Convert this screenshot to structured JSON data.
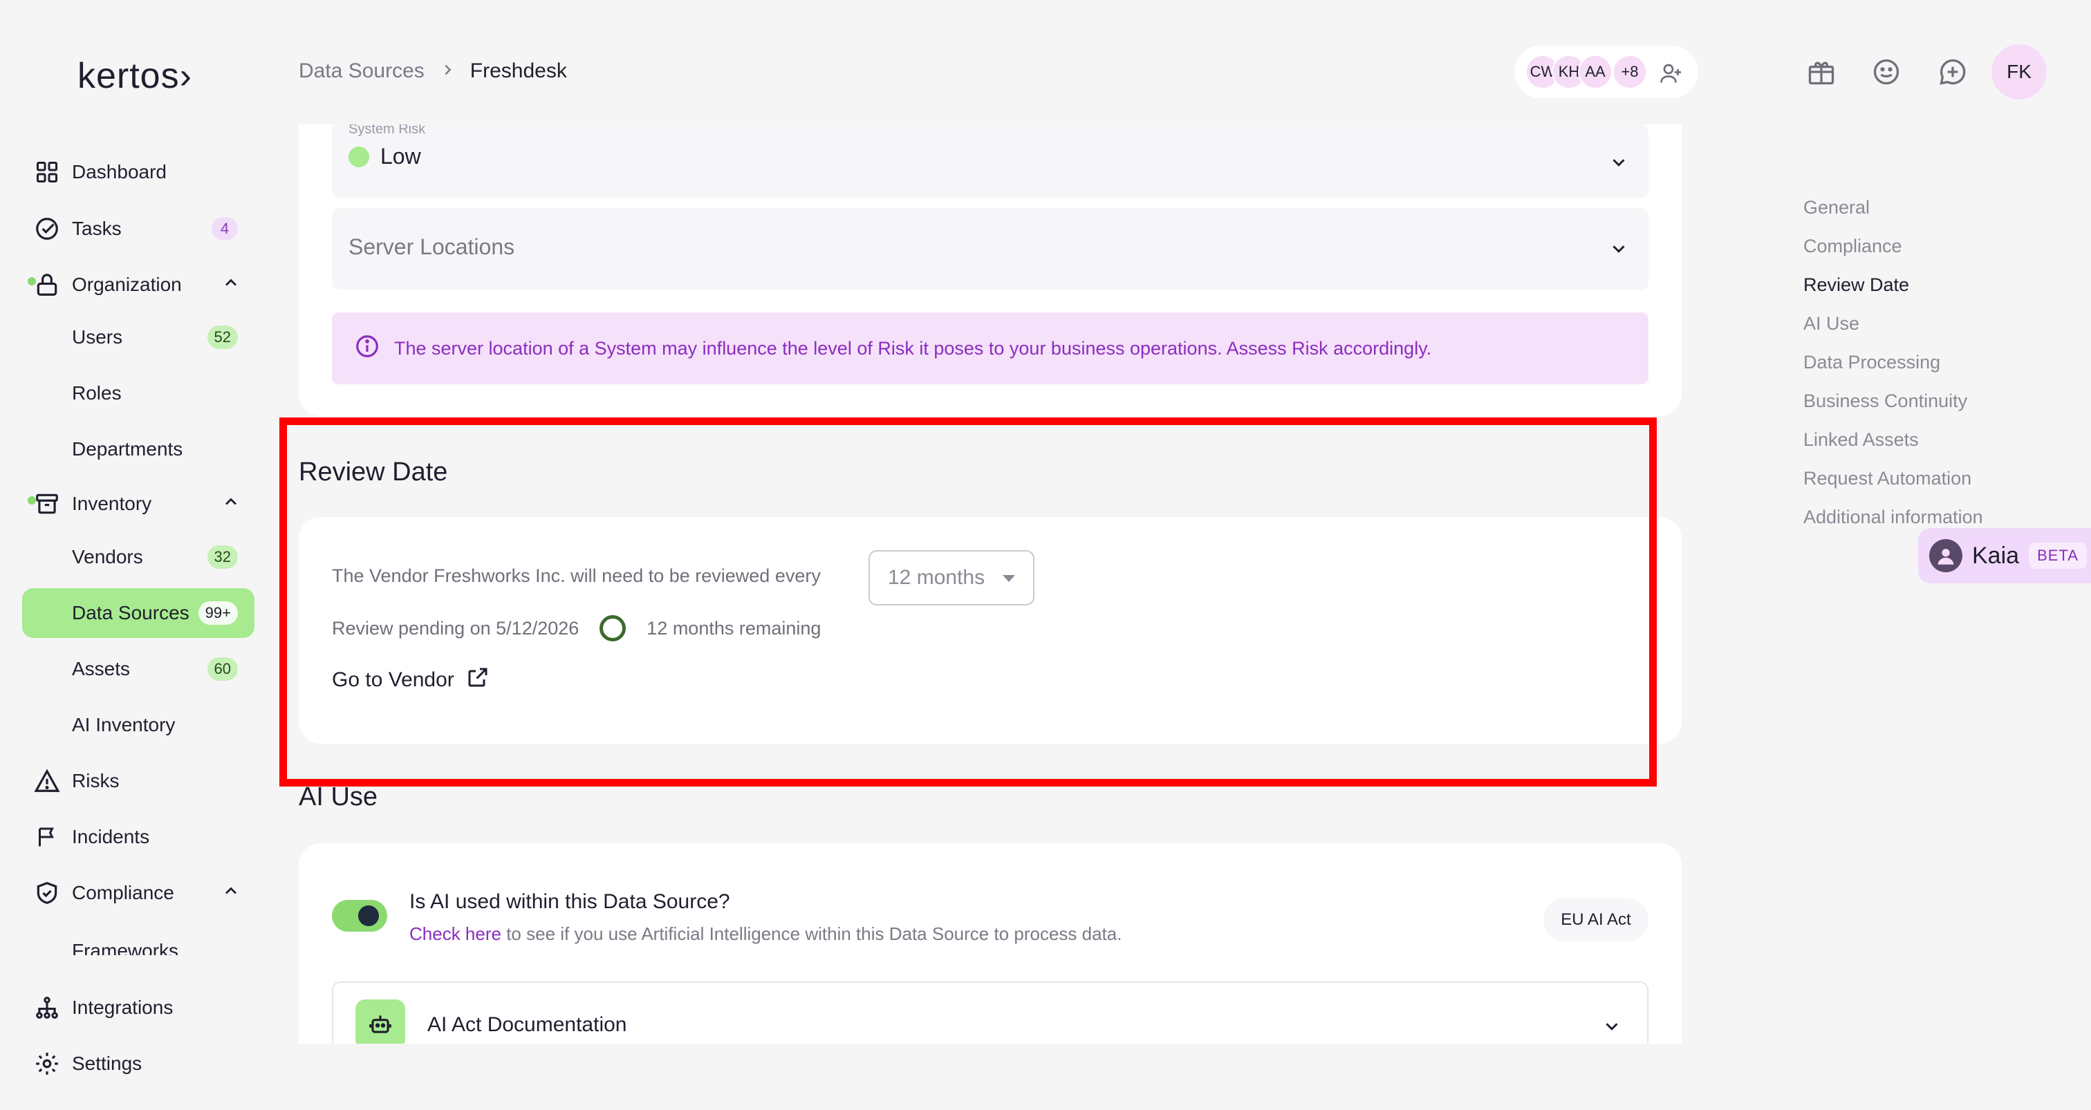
{
  "app": {
    "logo": "kertos›"
  },
  "sidebar": {
    "items": [
      {
        "label": "Dashboard",
        "icon": "dashboard-grid-icon"
      },
      {
        "label": "Tasks",
        "badge": "4",
        "icon": "check-circle-icon"
      },
      {
        "label": "Organization",
        "icon": "lock-icon",
        "expanded": true
      },
      {
        "label": "Users",
        "badge": "52"
      },
      {
        "label": "Roles"
      },
      {
        "label": "Departments"
      },
      {
        "label": "Inventory",
        "icon": "archive-box-icon",
        "expanded": true
      },
      {
        "label": "Vendors",
        "badge": "32"
      },
      {
        "label": "Data Sources",
        "badge": "99+",
        "active": true
      },
      {
        "label": "Assets",
        "badge": "60"
      },
      {
        "label": "AI Inventory"
      },
      {
        "label": "Risks",
        "icon": "warning-triangle-icon"
      },
      {
        "label": "Incidents",
        "icon": "flag-icon"
      },
      {
        "label": "Compliance",
        "icon": "shield-check-icon",
        "expanded": true
      },
      {
        "label": "Frameworks"
      },
      {
        "label": "Integrations",
        "icon": "hierarchy-icon"
      },
      {
        "label": "Settings",
        "icon": "gear-icon"
      }
    ]
  },
  "header": {
    "breadcrumb": [
      "Data Sources",
      "Freshdesk"
    ],
    "collaborators": [
      "CW",
      "KH",
      "AA"
    ],
    "collaborators_more": "+8",
    "user_initials": "FK"
  },
  "risk": {
    "label": "System Risk",
    "value": "Low",
    "server_locations_placeholder": "Server Locations",
    "info_banner": "The server location of a System may influence the level of Risk it poses to your business operations. Assess Risk accordingly."
  },
  "review": {
    "title": "Review Date",
    "sentence": "The Vendor Freshworks Inc. will need to be reviewed every",
    "interval": "12 months",
    "pending": "Review pending on 5/12/2026",
    "remaining": "12 months remaining",
    "go_to_vendor": "Go to Vendor"
  },
  "ai_use": {
    "title": "AI Use",
    "question": "Is AI used within this Data Source?",
    "link": "Check here",
    "sub": "to see if you use Artificial Intelligence within this Data Source to process data.",
    "pill": "EU AI Act",
    "accordion": "AI Act Documentation",
    "toggle_on": true
  },
  "anchors": [
    {
      "label": "General"
    },
    {
      "label": "Compliance"
    },
    {
      "label": "Review Date",
      "active": true
    },
    {
      "label": "AI Use"
    },
    {
      "label": "Data Processing"
    },
    {
      "label": "Business Continuity"
    },
    {
      "label": "Linked Assets"
    },
    {
      "label": "Request Automation"
    },
    {
      "label": "Additional information"
    }
  ],
  "assistant": {
    "name": "Kaia",
    "tag": "BETA"
  },
  "colors": {
    "accent_green": "#a7ea8f",
    "accent_purple": "#8a2dc0",
    "highlight": "#ff0000"
  }
}
